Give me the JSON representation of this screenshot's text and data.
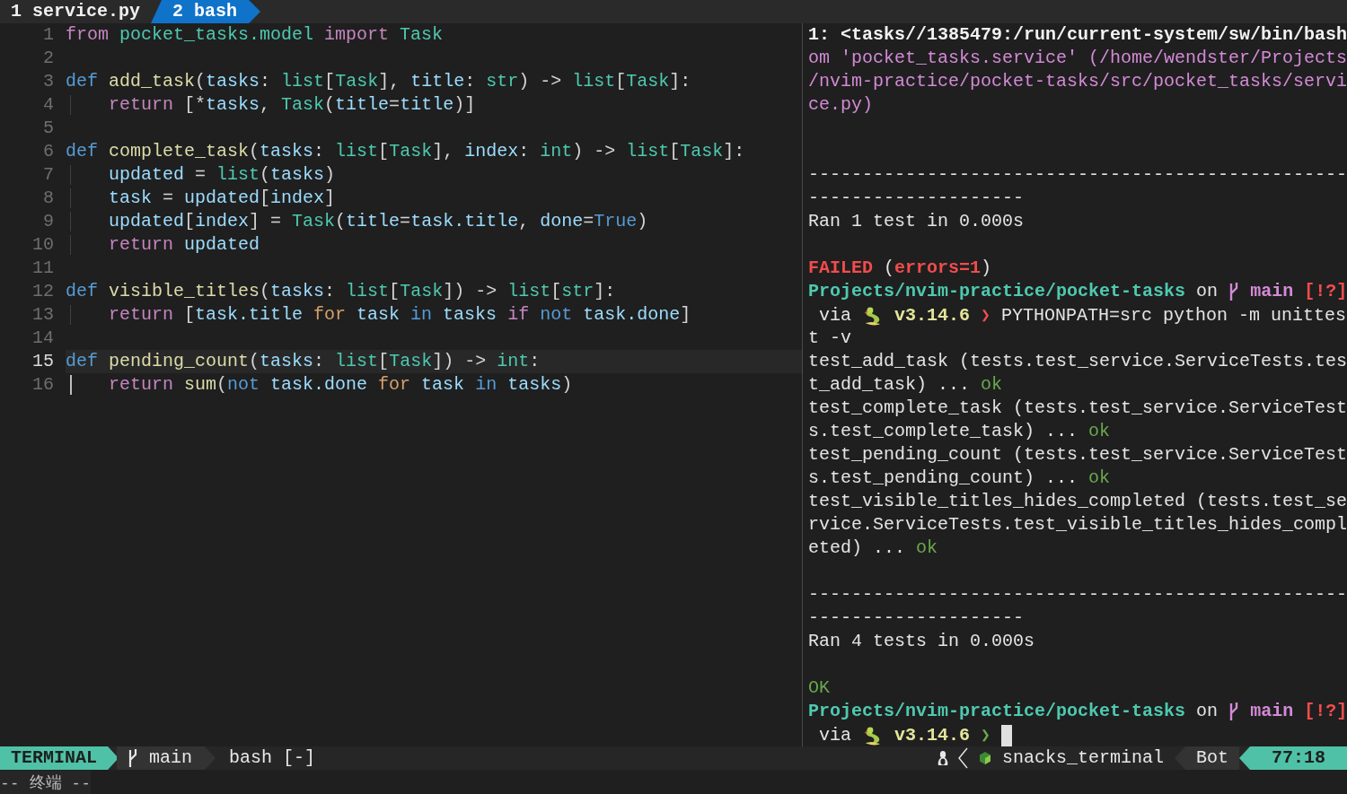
{
  "tabs": [
    {
      "number": "1",
      "label": "service.py",
      "selected": false
    },
    {
      "number": "2",
      "label": "bash",
      "selected": true
    }
  ],
  "code_lines": [
    {
      "number": "1",
      "current": false,
      "guide": false,
      "tokens": [
        {
          "kind": "keyword",
          "text": "from"
        },
        {
          "kind": "type",
          "text": " pocket_tasks.model"
        },
        {
          "kind": "keyword",
          "text": " import"
        },
        {
          "kind": "type",
          "text": " Task"
        }
      ]
    },
    {
      "number": "2",
      "current": false,
      "guide": false
    },
    {
      "number": "3",
      "current": false,
      "guide": false,
      "tokens": [
        {
          "kind": "storage",
          "text": "def"
        },
        {
          "kind": "function",
          "text": " add_task"
        },
        {
          "kind": "punct",
          "text": "("
        },
        {
          "kind": "variable",
          "text": "tasks"
        },
        {
          "kind": "punct",
          "text": ": "
        },
        {
          "kind": "type",
          "text": "list"
        },
        {
          "kind": "punct",
          "text": "["
        },
        {
          "kind": "type",
          "text": "Task"
        },
        {
          "kind": "punct",
          "text": "], "
        },
        {
          "kind": "variable",
          "text": "title"
        },
        {
          "kind": "punct",
          "text": ": "
        },
        {
          "kind": "type",
          "text": "str"
        },
        {
          "kind": "punct",
          "text": ") -> "
        },
        {
          "kind": "type",
          "text": "list"
        },
        {
          "kind": "punct",
          "text": "["
        },
        {
          "kind": "type",
          "text": "Task"
        },
        {
          "kind": "punct",
          "text": "]:"
        }
      ]
    },
    {
      "number": "4",
      "current": false,
      "guide": true,
      "scope": false,
      "tokens": [
        {
          "kind": "keyword",
          "text": "return"
        },
        {
          "kind": "punct",
          "text": " [*"
        },
        {
          "kind": "variable",
          "text": "tasks"
        },
        {
          "kind": "punct",
          "text": ", "
        },
        {
          "kind": "type",
          "text": "Task"
        },
        {
          "kind": "punct",
          "text": "("
        },
        {
          "kind": "variable",
          "text": "title"
        },
        {
          "kind": "punct",
          "text": "="
        },
        {
          "kind": "variable",
          "text": "title"
        },
        {
          "kind": "punct",
          "text": ")]"
        }
      ]
    },
    {
      "number": "5",
      "current": false,
      "guide": false
    },
    {
      "number": "6",
      "current": false,
      "guide": false,
      "tokens": [
        {
          "kind": "storage",
          "text": "def"
        },
        {
          "kind": "function",
          "text": " complete_task"
        },
        {
          "kind": "punct",
          "text": "("
        },
        {
          "kind": "variable",
          "text": "tasks"
        },
        {
          "kind": "punct",
          "text": ": "
        },
        {
          "kind": "type",
          "text": "list"
        },
        {
          "kind": "punct",
          "text": "["
        },
        {
          "kind": "type",
          "text": "Task"
        },
        {
          "kind": "punct",
          "text": "], "
        },
        {
          "kind": "variable",
          "text": "index"
        },
        {
          "kind": "punct",
          "text": ": "
        },
        {
          "kind": "type",
          "text": "int"
        },
        {
          "kind": "punct",
          "text": ") -> "
        },
        {
          "kind": "type",
          "text": "list"
        },
        {
          "kind": "punct",
          "text": "["
        },
        {
          "kind": "type",
          "text": "Task"
        },
        {
          "kind": "punct",
          "text": "]:"
        }
      ]
    },
    {
      "number": "7",
      "current": false,
      "guide": true,
      "scope": false,
      "tokens": [
        {
          "kind": "variable",
          "text": "updated"
        },
        {
          "kind": "punct",
          "text": " = "
        },
        {
          "kind": "type",
          "text": "list"
        },
        {
          "kind": "punct",
          "text": "("
        },
        {
          "kind": "variable",
          "text": "tasks"
        },
        {
          "kind": "punct",
          "text": ")"
        }
      ]
    },
    {
      "number": "8",
      "current": false,
      "guide": true,
      "scope": false,
      "tokens": [
        {
          "kind": "variable",
          "text": "task"
        },
        {
          "kind": "punct",
          "text": " = "
        },
        {
          "kind": "variable",
          "text": "updated"
        },
        {
          "kind": "punct",
          "text": "["
        },
        {
          "kind": "variable",
          "text": "index"
        },
        {
          "kind": "punct",
          "text": "]"
        }
      ]
    },
    {
      "number": "9",
      "current": false,
      "guide": true,
      "scope": false,
      "tokens": [
        {
          "kind": "variable",
          "text": "updated"
        },
        {
          "kind": "punct",
          "text": "["
        },
        {
          "kind": "variable",
          "text": "index"
        },
        {
          "kind": "punct",
          "text": "] = "
        },
        {
          "kind": "type",
          "text": "Task"
        },
        {
          "kind": "punct",
          "text": "("
        },
        {
          "kind": "variable",
          "text": "title"
        },
        {
          "kind": "punct",
          "text": "="
        },
        {
          "kind": "variable",
          "text": "task.title"
        },
        {
          "kind": "punct",
          "text": ", "
        },
        {
          "kind": "variable",
          "text": "done"
        },
        {
          "kind": "punct",
          "text": "="
        },
        {
          "kind": "constant",
          "text": "True"
        },
        {
          "kind": "punct",
          "text": ")"
        }
      ]
    },
    {
      "number": "10",
      "current": false,
      "guide": true,
      "scope": false,
      "tokens": [
        {
          "kind": "keyword",
          "text": "return"
        },
        {
          "kind": "variable",
          "text": " updated"
        }
      ]
    },
    {
      "number": "11",
      "current": false,
      "guide": false
    },
    {
      "number": "12",
      "current": false,
      "guide": false,
      "tokens": [
        {
          "kind": "storage",
          "text": "def"
        },
        {
          "kind": "function",
          "text": " visible_titles"
        },
        {
          "kind": "punct",
          "text": "("
        },
        {
          "kind": "variable",
          "text": "tasks"
        },
        {
          "kind": "punct",
          "text": ": "
        },
        {
          "kind": "type",
          "text": "list"
        },
        {
          "kind": "punct",
          "text": "["
        },
        {
          "kind": "type",
          "text": "Task"
        },
        {
          "kind": "punct",
          "text": "]) -> "
        },
        {
          "kind": "type",
          "text": "list"
        },
        {
          "kind": "punct",
          "text": "["
        },
        {
          "kind": "type",
          "text": "str"
        },
        {
          "kind": "punct",
          "text": "]:"
        }
      ]
    },
    {
      "number": "13",
      "current": false,
      "guide": true,
      "scope": false,
      "tokens": [
        {
          "kind": "keyword",
          "text": "return"
        },
        {
          "kind": "punct",
          "text": " ["
        },
        {
          "kind": "variable",
          "text": "task.title"
        },
        {
          "kind": "loop",
          "text": " for"
        },
        {
          "kind": "variable",
          "text": " task"
        },
        {
          "kind": "constant",
          "text": " in"
        },
        {
          "kind": "variable",
          "text": " tasks"
        },
        {
          "kind": "keyword",
          "text": " if"
        },
        {
          "kind": "constant",
          "text": " not"
        },
        {
          "kind": "variable",
          "text": " task.done"
        },
        {
          "kind": "punct",
          "text": "]"
        }
      ]
    },
    {
      "number": "14",
      "current": false,
      "guide": false
    },
    {
      "number": "15",
      "current": true,
      "guide": false,
      "tokens": [
        {
          "kind": "storage",
          "text": "def"
        },
        {
          "kind": "function",
          "text": " pending_count"
        },
        {
          "kind": "punct",
          "text": "("
        },
        {
          "kind": "variable",
          "text": "tasks"
        },
        {
          "kind": "punct",
          "text": ": "
        },
        {
          "kind": "type",
          "text": "list"
        },
        {
          "kind": "punct",
          "text": "["
        },
        {
          "kind": "type",
          "text": "Task"
        },
        {
          "kind": "punct",
          "text": "]) -> "
        },
        {
          "kind": "type",
          "text": "int"
        },
        {
          "kind": "punct",
          "text": ":"
        }
      ]
    },
    {
      "number": "16",
      "current": false,
      "guide": true,
      "scope": true,
      "tokens": [
        {
          "kind": "keyword",
          "text": "return"
        },
        {
          "kind": "function",
          "text": " sum"
        },
        {
          "kind": "punct",
          "text": "("
        },
        {
          "kind": "constant",
          "text": "not"
        },
        {
          "kind": "variable",
          "text": " task.done"
        },
        {
          "kind": "loop",
          "text": " for"
        },
        {
          "kind": "variable",
          "text": " task"
        },
        {
          "kind": "constant",
          "text": " in"
        },
        {
          "kind": "variable",
          "text": " tasks"
        },
        {
          "kind": "punct",
          "text": ")"
        }
      ]
    }
  ],
  "terminal_lines": [
    {
      "kind": "text",
      "segments": [
        {
          "kind": "bright",
          "text": "1: <tasks//1385479:/run/current-system/sw/bin/bash"
        }
      ]
    },
    {
      "kind": "text",
      "segments": [
        {
          "kind": "path",
          "text": "om 'pocket_tasks.service' (/home/wendster/Projects"
        }
      ]
    },
    {
      "kind": "text",
      "segments": [
        {
          "kind": "path",
          "text": "/nvim-practice/pocket-tasks/src/pocket_tasks/servi"
        }
      ]
    },
    {
      "kind": "text",
      "segments": [
        {
          "kind": "path",
          "text": "ce.py)"
        }
      ]
    },
    {
      "kind": "blank"
    },
    {
      "kind": "blank"
    },
    {
      "kind": "text",
      "segments": [
        {
          "kind": "plain",
          "text": "--------------------------------------------------"
        }
      ]
    },
    {
      "kind": "text",
      "segments": [
        {
          "kind": "plain",
          "text": "--------------------"
        }
      ]
    },
    {
      "kind": "text",
      "segments": [
        {
          "kind": "plain",
          "text": "Ran 1 test in 0.000s"
        }
      ]
    },
    {
      "kind": "blank"
    },
    {
      "kind": "text",
      "segments": [
        {
          "kind": "error",
          "text": "FAILED"
        },
        {
          "kind": "plain",
          "text": " ("
        },
        {
          "kind": "error",
          "text": "errors=1"
        },
        {
          "kind": "plain",
          "text": ")"
        }
      ]
    },
    {
      "kind": "prompt",
      "path": "Projects/nvim-practice/pocket-tasks",
      "on": "on",
      "branch": "main",
      "status": "[!?]"
    },
    {
      "kind": "command",
      "via": "via",
      "version": "v3.14.6",
      "arrow": "❯",
      "last_ok": false,
      "command": "PYTHONPATH=src python -m unittes",
      "cursor": false
    },
    {
      "kind": "text",
      "segments": [
        {
          "kind": "plain",
          "text": "t -v"
        }
      ]
    },
    {
      "kind": "text",
      "segments": [
        {
          "kind": "plain",
          "text": "test_add_task (tests.test_service.ServiceTests.tes"
        }
      ]
    },
    {
      "kind": "text",
      "segments": [
        {
          "kind": "plain",
          "text": "t_add_task) ... "
        },
        {
          "kind": "pass",
          "text": "ok"
        }
      ]
    },
    {
      "kind": "text",
      "segments": [
        {
          "kind": "plain",
          "text": "test_complete_task (tests.test_service.ServiceTest"
        }
      ]
    },
    {
      "kind": "text",
      "segments": [
        {
          "kind": "plain",
          "text": "s.test_complete_task) ... "
        },
        {
          "kind": "pass",
          "text": "ok"
        }
      ]
    },
    {
      "kind": "text",
      "segments": [
        {
          "kind": "plain",
          "text": "test_pending_count (tests.test_service.ServiceTest"
        }
      ]
    },
    {
      "kind": "text",
      "segments": [
        {
          "kind": "plain",
          "text": "s.test_pending_count) ... "
        },
        {
          "kind": "pass",
          "text": "ok"
        }
      ]
    },
    {
      "kind": "text",
      "segments": [
        {
          "kind": "plain",
          "text": "test_visible_titles_hides_completed (tests.test_se"
        }
      ]
    },
    {
      "kind": "text",
      "segments": [
        {
          "kind": "plain",
          "text": "rvice.ServiceTests.test_visible_titles_hides_compl"
        }
      ]
    },
    {
      "kind": "text",
      "segments": [
        {
          "kind": "plain",
          "text": "eted) ... "
        },
        {
          "kind": "pass",
          "text": "ok"
        }
      ]
    },
    {
      "kind": "blank"
    },
    {
      "kind": "text",
      "segments": [
        {
          "kind": "plain",
          "text": "--------------------------------------------------"
        }
      ]
    },
    {
      "kind": "text",
      "segments": [
        {
          "kind": "plain",
          "text": "--------------------"
        }
      ]
    },
    {
      "kind": "text",
      "segments": [
        {
          "kind": "plain",
          "text": "Ran 4 tests in 0.000s"
        }
      ]
    },
    {
      "kind": "blank"
    },
    {
      "kind": "text",
      "segments": [
        {
          "kind": "pass",
          "text": "OK"
        }
      ]
    },
    {
      "kind": "prompt",
      "path": "Projects/nvim-practice/pocket-tasks",
      "on": "on",
      "branch": "main",
      "status": "[!?]"
    },
    {
      "kind": "command",
      "via": "via",
      "version": "v3.14.6",
      "arrow": "❯",
      "last_ok": true,
      "cursor": true
    }
  ],
  "status_bar": {
    "mode": "TERMINAL",
    "branch": "main",
    "buffer": "bash [-]",
    "filetype": "snacks_terminal",
    "position": "Bot",
    "cursor_position": "77:18"
  },
  "command_line": "-- 终端 --"
}
